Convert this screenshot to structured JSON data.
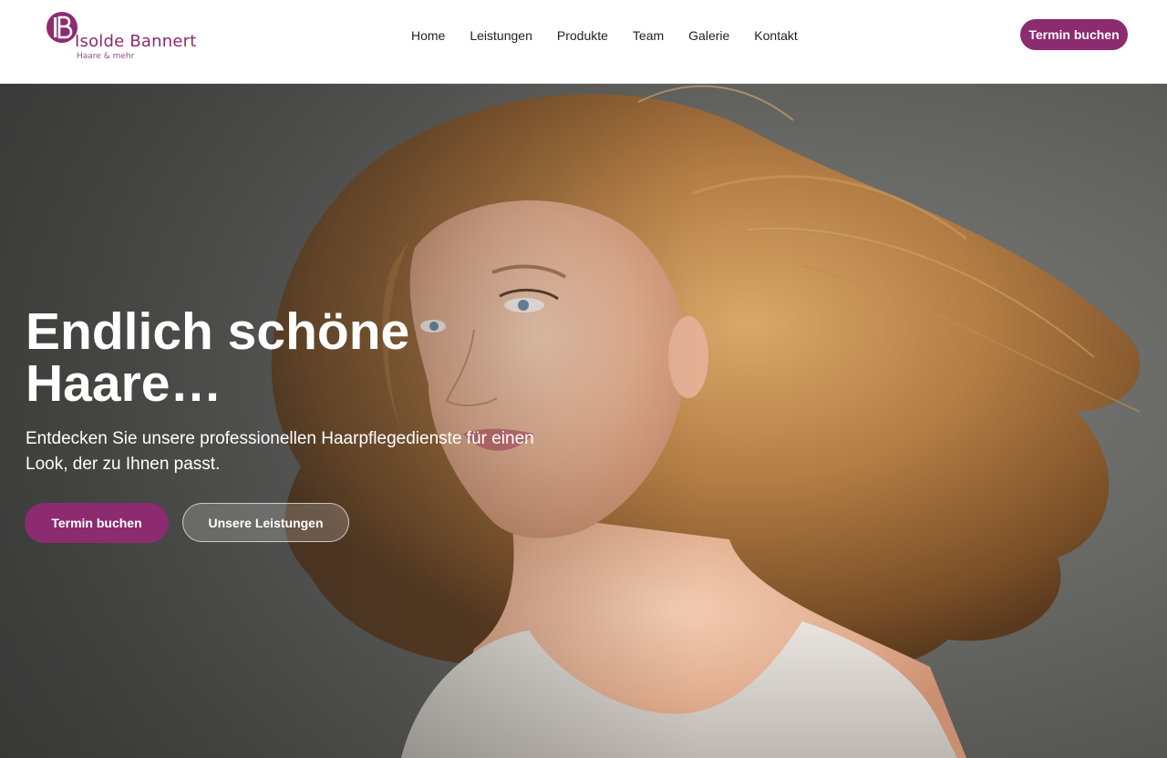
{
  "brand": {
    "name": "Isolde Bannert",
    "tagline": "Haare & mehr",
    "monogram": "IB",
    "color": "#8c2b70"
  },
  "nav": {
    "items": [
      {
        "label": "Home"
      },
      {
        "label": "Leistungen"
      },
      {
        "label": "Produkte"
      },
      {
        "label": "Team"
      },
      {
        "label": "Galerie"
      },
      {
        "label": "Kontakt"
      }
    ],
    "cta_label": "Termin buchen"
  },
  "hero": {
    "title": "Endlich schöne\nHaare…",
    "subtitle": "Entdecken Sie unsere professionellen Haarpflegedienste für einen Look, der zu Ihnen passt.",
    "primary_label": "Termin buchen",
    "secondary_label": "Unsere Leistungen"
  }
}
